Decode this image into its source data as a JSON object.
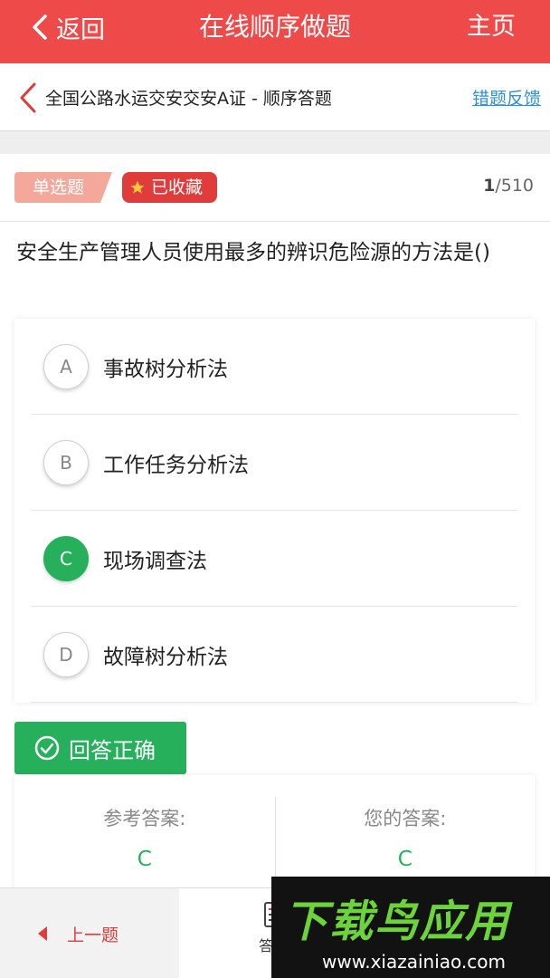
{
  "topbar": {
    "back_label": "返回",
    "title": "在线顺序做题",
    "home_label": "主页",
    "bg_color": "#ef4a4a"
  },
  "subheader": {
    "title": "全国公路水运交安交安A证 - 顺序答题",
    "feedback_label": "错题反馈"
  },
  "question": {
    "type_tag": "单选题",
    "favorite_tag": "已收藏",
    "counter_current": "1",
    "counter_total": "/510",
    "text": "安全生产管理人员使用最多的辨识危险源的方法是()",
    "options": [
      {
        "letter": "A",
        "text": "事故树分析法"
      },
      {
        "letter": "B",
        "text": "工作任务分析法"
      },
      {
        "letter": "C",
        "text": "现场调查法"
      },
      {
        "letter": "D",
        "text": "故障树分析法"
      }
    ]
  },
  "result": {
    "badge": "回答正确",
    "reference_label": "参考答案:",
    "reference_value": "C",
    "yours_label": "您的答案:",
    "yours_value": "C",
    "correct_color": "#26b05c"
  },
  "bottombar": {
    "prev_label": "上一题",
    "sheet_label": "答题"
  },
  "watermark": {
    "brand": "下载鸟应用",
    "url": "www.xiazainiao.com"
  }
}
